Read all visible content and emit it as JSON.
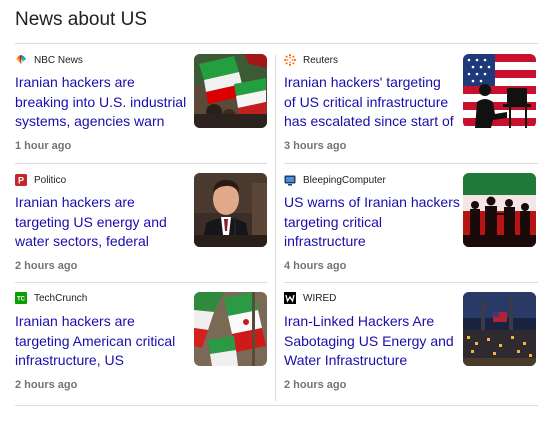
{
  "section_title": "News about US",
  "colors": {
    "link": "#1a0dab",
    "time": "#70757a",
    "divider": "#dadce0"
  },
  "articles": [
    {
      "source": "NBC News",
      "source_icon": "nbc-peacock-icon",
      "title": "Iranian hackers are breaking into U.S. industrial systems, agencies warn",
      "time": "1 hour ago",
      "thumbnail": "crowd-with-iranian-flags-image"
    },
    {
      "source": "Reuters",
      "source_icon": "reuters-logo-icon",
      "title": "Iranian hackers' targeting of US critical infrastructure has escalated since start of war...",
      "time": "3 hours ago",
      "thumbnail": "hacker-silhouette-us-flag-image"
    },
    {
      "source": "Politico",
      "source_icon": "politico-logo-icon",
      "title": "Iranian hackers are targeting US energy and water sectors, federal agencies warn",
      "time": "2 hours ago",
      "thumbnail": "official-speaking-at-podium-image"
    },
    {
      "source": "BleepingComputer",
      "source_icon": "bleepingcomputer-logo-icon",
      "title": "US warns of Iranian hackers targeting critical infrastructure",
      "time": "4 hours ago",
      "thumbnail": "soldier-silhouettes-iran-flag-image"
    },
    {
      "source": "TechCrunch",
      "source_icon": "techcrunch-logo-icon",
      "title": "Iranian hackers are targeting American critical infrastructure, US agencies...",
      "time": "2 hours ago",
      "thumbnail": "iranian-flags-closeup-image"
    },
    {
      "source": "WIRED",
      "source_icon": "wired-logo-icon",
      "title": "Iran-Linked Hackers Are Sabotaging US Energy and Water Infrastructure",
      "time": "2 hours ago",
      "thumbnail": "industrial-plant-at-night-image"
    }
  ]
}
